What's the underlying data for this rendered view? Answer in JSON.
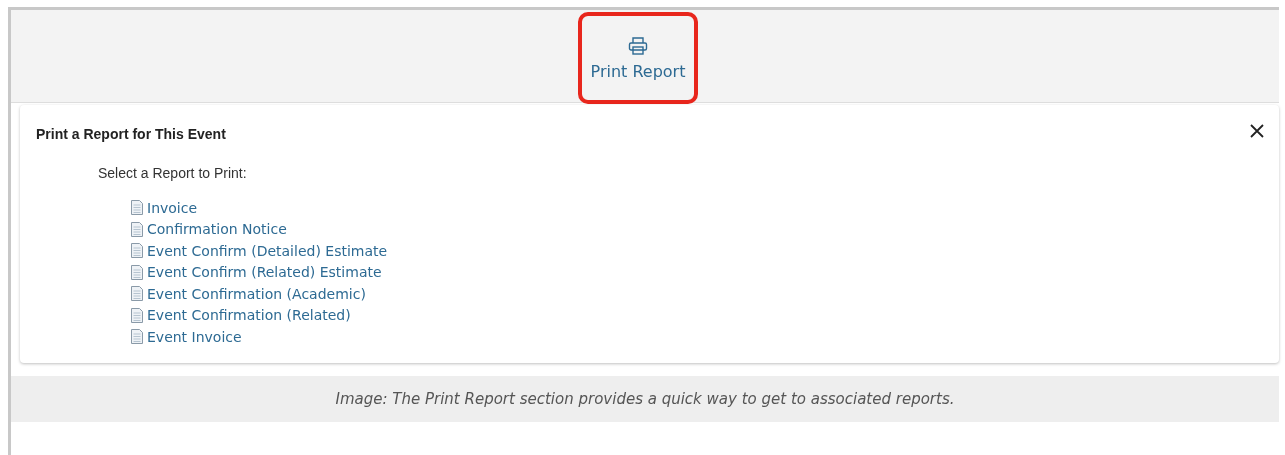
{
  "toolbar": {
    "print_button": {
      "label": "Print Report",
      "highlighted": true
    }
  },
  "panel": {
    "title": "Print a Report for This Event",
    "prompt": "Select a Report to Print:",
    "reports": [
      "Invoice",
      "Confirmation Notice",
      "Event Confirm (Detailed) Estimate",
      "Event Confirm (Related) Estimate",
      "Event Confirmation (Academic)",
      "Event Confirmation (Related)",
      "Event Invoice"
    ]
  },
  "caption": "Image: The Print Report section provides a quick way to get to associated reports."
}
